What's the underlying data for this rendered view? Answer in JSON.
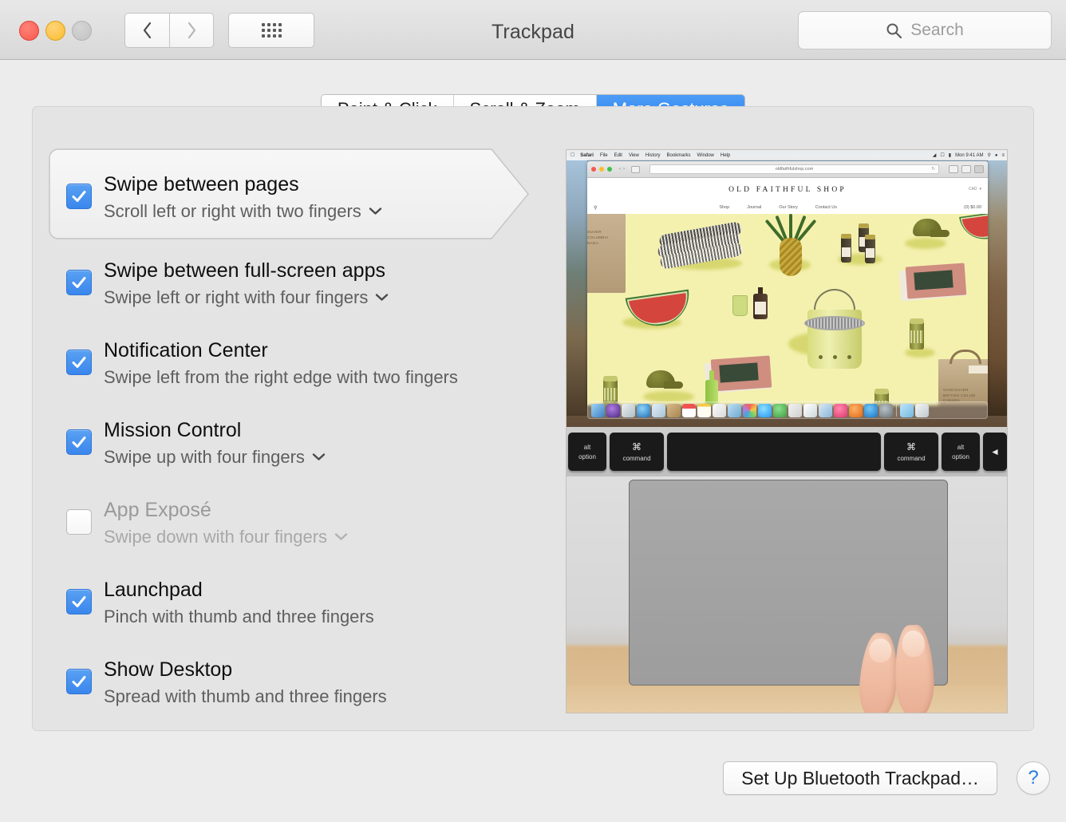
{
  "window": {
    "title": "Trackpad",
    "traffic_lights": [
      "close",
      "minimize",
      "zoom"
    ],
    "nav": {
      "back_label": "Back",
      "forward_label": "Forward",
      "grid_label": "Show All"
    },
    "search": {
      "placeholder": "Search",
      "value": "",
      "icon": "search-icon"
    }
  },
  "tabs": [
    {
      "label": "Point & Click",
      "active": false
    },
    {
      "label": "Scroll & Zoom",
      "active": false
    },
    {
      "label": "More Gestures",
      "active": true
    }
  ],
  "gestures": [
    {
      "title": "Swipe between pages",
      "subtitle": "Scroll left or right with two fingers",
      "checked": true,
      "enabled": true,
      "has_dropdown": true,
      "callout": true
    },
    {
      "title": "Swipe between full-screen apps",
      "subtitle": "Swipe left or right with four fingers",
      "checked": true,
      "enabled": true,
      "has_dropdown": true,
      "callout": false
    },
    {
      "title": "Notification Center",
      "subtitle": "Swipe left from the right edge with two fingers",
      "checked": true,
      "enabled": true,
      "has_dropdown": false,
      "callout": false
    },
    {
      "title": "Mission Control",
      "subtitle": "Swipe up with four fingers",
      "checked": true,
      "enabled": true,
      "has_dropdown": true,
      "callout": false
    },
    {
      "title": "App Exposé",
      "subtitle": "Swipe down with four fingers",
      "checked": false,
      "enabled": false,
      "has_dropdown": true,
      "callout": false
    },
    {
      "title": "Launchpad",
      "subtitle": "Pinch with thumb and three fingers",
      "checked": true,
      "enabled": true,
      "has_dropdown": false,
      "callout": false
    },
    {
      "title": "Show Desktop",
      "subtitle": "Spread with thumb and three fingers",
      "checked": true,
      "enabled": true,
      "has_dropdown": false,
      "callout": false
    }
  ],
  "preview": {
    "menubar": {
      "apple": "apple-icon",
      "items": [
        "Safari",
        "File",
        "Edit",
        "View",
        "History",
        "Bookmarks",
        "Window",
        "Help"
      ],
      "status_items": [
        "wifi-icon",
        "airplay-icon",
        "battery-icon"
      ],
      "clock": "Mon 9:41 AM",
      "right_icons": [
        "spotlight-icon",
        "siri-icon",
        "control-center-icon"
      ]
    },
    "safari": {
      "url": "oldfaithfulshop.com",
      "reload": "reload-icon"
    },
    "site": {
      "title": "OLD FAITHFUL SHOP",
      "currency": "CAD",
      "nav": [
        "Shop",
        "Journal",
        "Our Story",
        "Contact Us"
      ],
      "cart": "(0) $0.00",
      "search_icon": "search-icon"
    },
    "keyboard": [
      {
        "top": "alt",
        "bottom": "option",
        "kind": "alt"
      },
      {
        "top": "⌘",
        "bottom": "command",
        "kind": "mod"
      },
      {
        "top": "",
        "bottom": "",
        "kind": "space"
      },
      {
        "top": "⌘",
        "bottom": "command",
        "kind": "mod"
      },
      {
        "top": "alt",
        "bottom": "option",
        "kind": "alt"
      },
      {
        "top": "◄",
        "bottom": "",
        "kind": "arrow"
      }
    ],
    "dock_icons": [
      "#4aa3df",
      "#7b4fc1",
      "#d7dadd",
      "#4da5e8",
      "#cfd6da",
      "#c09a62",
      "#ef5350",
      "#fbfbf5",
      "#f5f3ea",
      "#8bc34a",
      "#ef5a7b",
      "#4fc3f7",
      "#66bb6a",
      "#eceff1",
      "#ef6c00",
      "#42a5f5",
      "#ec407a",
      "#e65100",
      "#29b6f6",
      "#78909c",
      "#81d4fa",
      "#eceff1"
    ]
  },
  "footer": {
    "bluetooth_button": "Set Up Bluetooth Trackpad…",
    "help_button": "?"
  },
  "colors": {
    "accent": "#3a86ec",
    "tab_active": "#2a81ef",
    "window_bg": "#ececec",
    "panel_bg": "#e4e4e4",
    "help_blue": "#2a7ae4"
  }
}
